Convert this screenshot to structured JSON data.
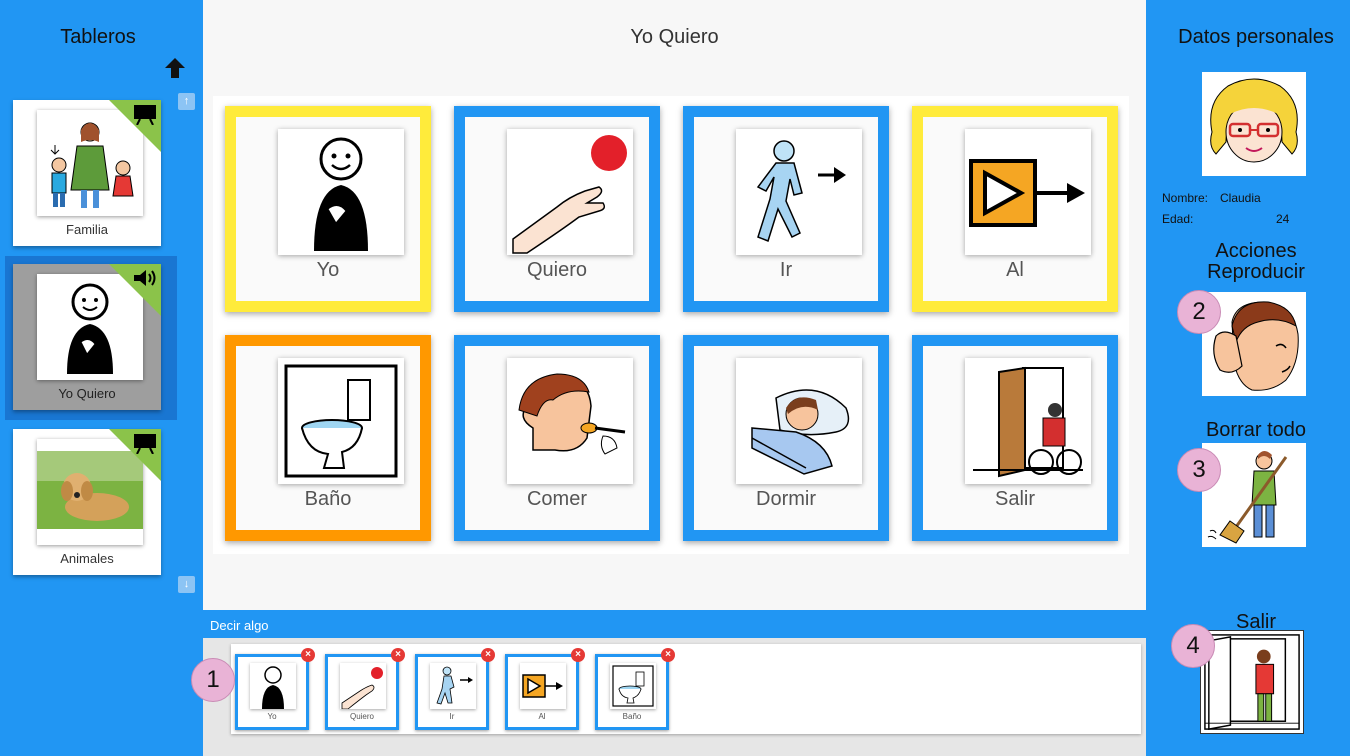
{
  "sidebar": {
    "title": "Tableros",
    "boards": [
      {
        "label": "Familia",
        "badge": "board-icon"
      },
      {
        "label": "Yo Quiero",
        "badge": "speaker-icon"
      },
      {
        "label": "Animales",
        "badge": "board-icon"
      }
    ],
    "badge_color": "#8bc34a"
  },
  "main": {
    "title": "Yo Quiero",
    "cards": [
      {
        "label": "Yo",
        "color": "#ffeb3b"
      },
      {
        "label": "Quiero",
        "color": "#2196f3"
      },
      {
        "label": "Ir",
        "color": "#2196f3"
      },
      {
        "label": "Al",
        "color": "#ffeb3b"
      },
      {
        "label": "Baño",
        "color": "#ff9800"
      },
      {
        "label": "Comer",
        "color": "#2196f3"
      },
      {
        "label": "Dormir",
        "color": "#2196f3"
      },
      {
        "label": "Salir",
        "color": "#2196f3"
      }
    ]
  },
  "sentence": {
    "header": "Decir algo",
    "items": [
      "Yo",
      "Quiero",
      "Ir",
      "Al",
      "Baño"
    ]
  },
  "profile": {
    "title": "Datos personales",
    "name_label": "Nombre:",
    "name_value": "Claudia",
    "age_label": "Edad:",
    "age_value": "24"
  },
  "actions": {
    "play_title_1": "Acciones",
    "play_title_2": "Reproducir",
    "clear_title": "Borrar todo",
    "exit_title": "Salir"
  },
  "callouts": [
    "1",
    "2",
    "3",
    "4"
  ]
}
